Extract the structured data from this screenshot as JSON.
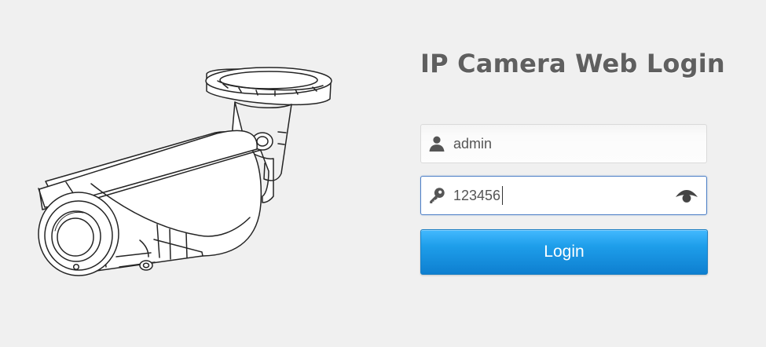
{
  "login": {
    "title": "IP Camera Web Login",
    "username": {
      "value": "admin",
      "icon": "user-icon"
    },
    "password": {
      "value": "123456",
      "icon": "key-icon",
      "reveal_icon": "eye-icon"
    },
    "button_label": "Login"
  },
  "illustration": {
    "icon": "bullet-camera-illustration"
  },
  "colors": {
    "background": "#f0f0f0",
    "title": "#5f5f5f",
    "button_top": "#43b9ff",
    "button_bottom": "#0e7fd0",
    "focus_border": "#4d7fc6"
  }
}
